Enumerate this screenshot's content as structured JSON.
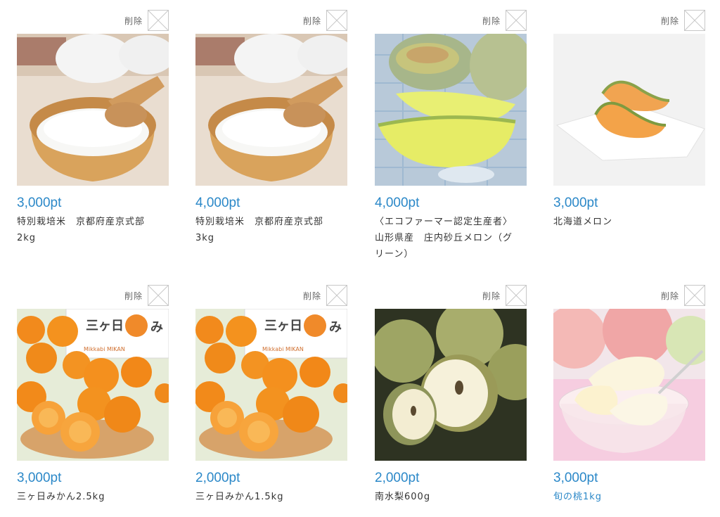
{
  "delete_label": "削除",
  "items": [
    {
      "points": "3,000pt",
      "name": "特別栽培米　京都府産京式部\n2kg",
      "image": "rice-bowl",
      "link": false
    },
    {
      "points": "4,000pt",
      "name": "特別栽培米　京都府産京式部\n3kg",
      "image": "rice-bowl",
      "link": false
    },
    {
      "points": "4,000pt",
      "name": "〈エコファーマー認定生産者〉\n山形県産　庄内砂丘メロン（グ\nリーン）",
      "image": "green-melon",
      "link": false
    },
    {
      "points": "3,000pt",
      "name": "北海道メロン",
      "image": "orange-melon",
      "link": false
    },
    {
      "points": "3,000pt",
      "name": "三ヶ日みかん2.5kg",
      "image": "mikan",
      "link": false
    },
    {
      "points": "2,000pt",
      "name": "三ヶ日みかん1.5kg",
      "image": "mikan",
      "link": false
    },
    {
      "points": "2,000pt",
      "name": "南水梨600g",
      "image": "pear",
      "link": false
    },
    {
      "points": "3,000pt",
      "name": "旬の桃1kg",
      "image": "peach",
      "link": true
    }
  ],
  "mikan_box_text": "三ヶ日",
  "mikan_box_text2": "み",
  "mikan_box_sub": "Mikkabi MIKAN",
  "colors": {
    "points": "#2b88c8",
    "link": "#2b88c8",
    "text": "#333333"
  }
}
